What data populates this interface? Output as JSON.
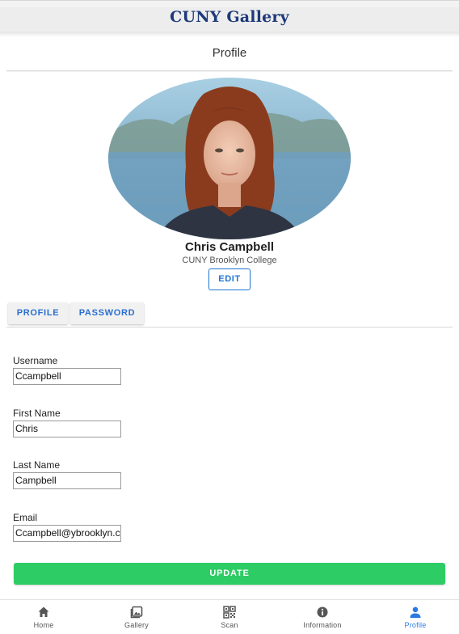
{
  "app": {
    "title": "CUNY Gallery"
  },
  "page": {
    "title": "Profile"
  },
  "profile": {
    "name": "Chris Campbell",
    "school": "CUNY Brooklyn College",
    "edit_label": "EDIT"
  },
  "tabs": [
    {
      "label": "PROFILE"
    },
    {
      "label": "PASSWORD"
    }
  ],
  "form": {
    "username": {
      "label": "Username",
      "value": "Ccampbell"
    },
    "first_name": {
      "label": "First Name",
      "value": "Chris"
    },
    "last_name": {
      "label": "Last Name",
      "value": "Campbell"
    },
    "email": {
      "label": "Email",
      "value": "Ccampbell@ybrooklyn.cc"
    },
    "submit_label": "UPDATE"
  },
  "nav": [
    {
      "label": "Home",
      "icon": "home-icon"
    },
    {
      "label": "Gallery",
      "icon": "gallery-icon"
    },
    {
      "label": "Scan",
      "icon": "qr-code-icon"
    },
    {
      "label": "Information",
      "icon": "info-icon"
    },
    {
      "label": "Profile",
      "icon": "person-icon",
      "active": true
    }
  ],
  "colors": {
    "brand": "#1f3a7a",
    "accent": "#2a7ae4",
    "update_button": "#2ecc64"
  }
}
